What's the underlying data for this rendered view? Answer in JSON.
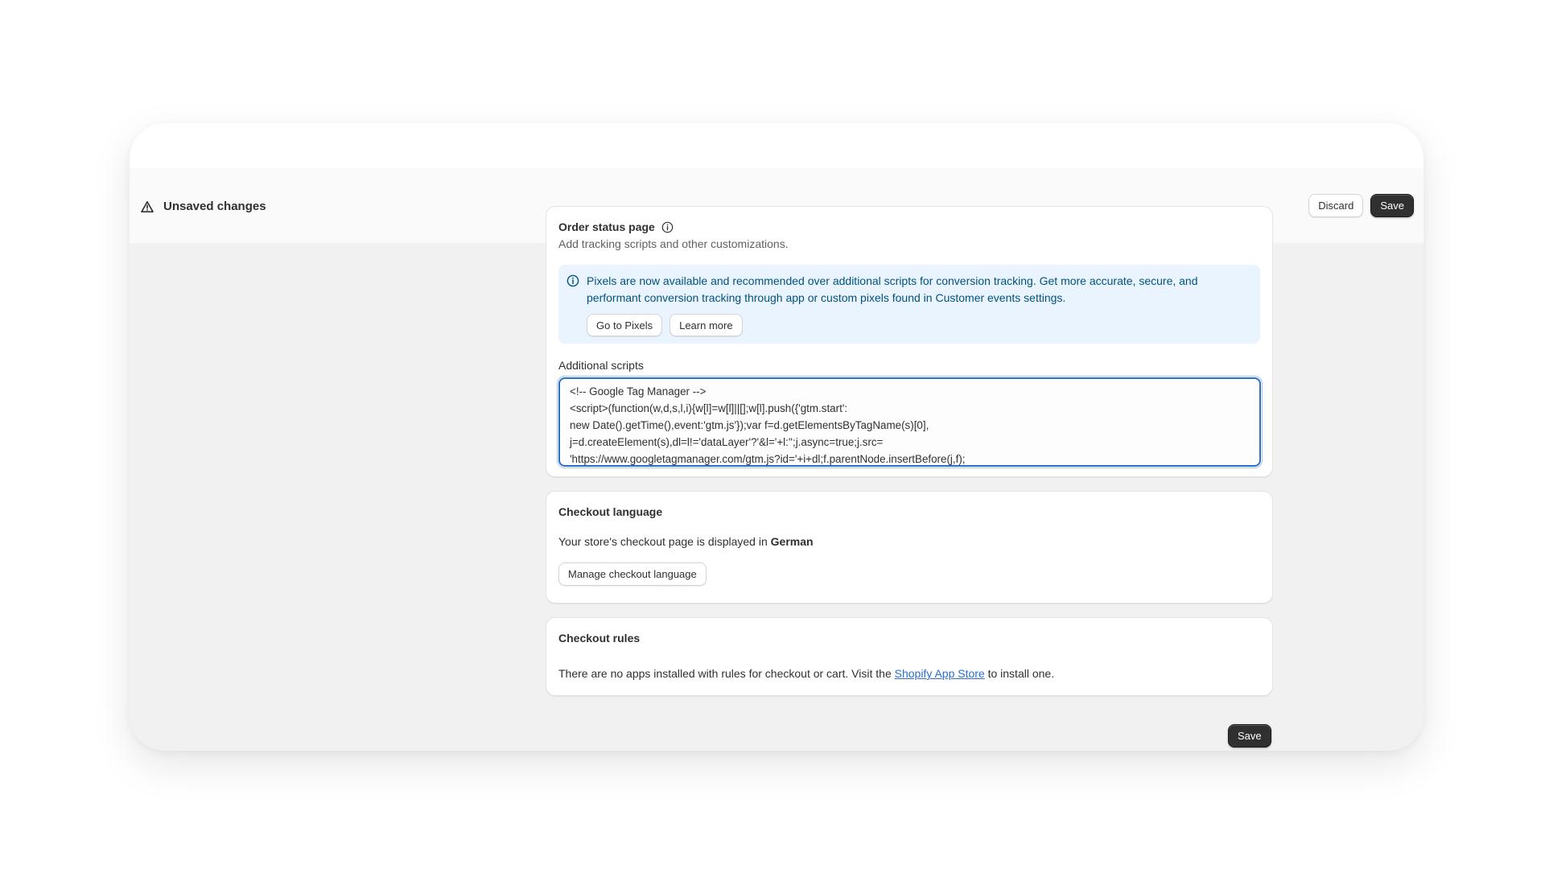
{
  "header": {
    "title": "Unsaved changes",
    "discard_label": "Discard",
    "save_label": "Save"
  },
  "order_status": {
    "title": "Order status page",
    "subtitle": "Add tracking scripts and other customizations.",
    "banner_line1": "Pixels are now available and recommended over additional scripts for conversion tracking. Get more accurate, secure, and",
    "banner_line2": "performant conversion tracking through app or custom pixels found in Customer events settings.",
    "go_to_pixels_label": "Go to Pixels",
    "learn_more_label": "Learn more",
    "scripts_label": "Additional scripts",
    "script_lines": [
      "<!-- Google Tag Manager -->",
      "<script>(function(w,d,s,l,i){w[l]=w[l]||[];w[l].push({'gtm.start':",
      "new Date().getTime(),event:'gtm.js'});var f=d.getElementsByTagName(s)[0],",
      "j=d.createElement(s),dl=l!='dataLayer'?'&l='+l:'';j.async=true;j.src=",
      "'https://www.googletagmanager.com/gtm.js?id='+i+dl;f.parentNode.insertBefore(j,f);"
    ]
  },
  "checkout_language": {
    "title": "Checkout language",
    "text_prefix": "Your store's checkout page is displayed in",
    "language": "German",
    "manage_label": "Manage checkout language"
  },
  "checkout_rules": {
    "title": "Checkout rules",
    "text_prefix": "There are no apps installed with rules for checkout or cart. Visit the",
    "link_text": "Shopify App Store",
    "text_suffix": "to install one."
  },
  "footer": {
    "save_label": "Save"
  },
  "colors": {
    "primary_button": "#303030",
    "banner_bg": "#eaf4ff",
    "banner_text": "#00527c",
    "focus_border": "#2c6ecb",
    "link": "#2c6ecb"
  }
}
